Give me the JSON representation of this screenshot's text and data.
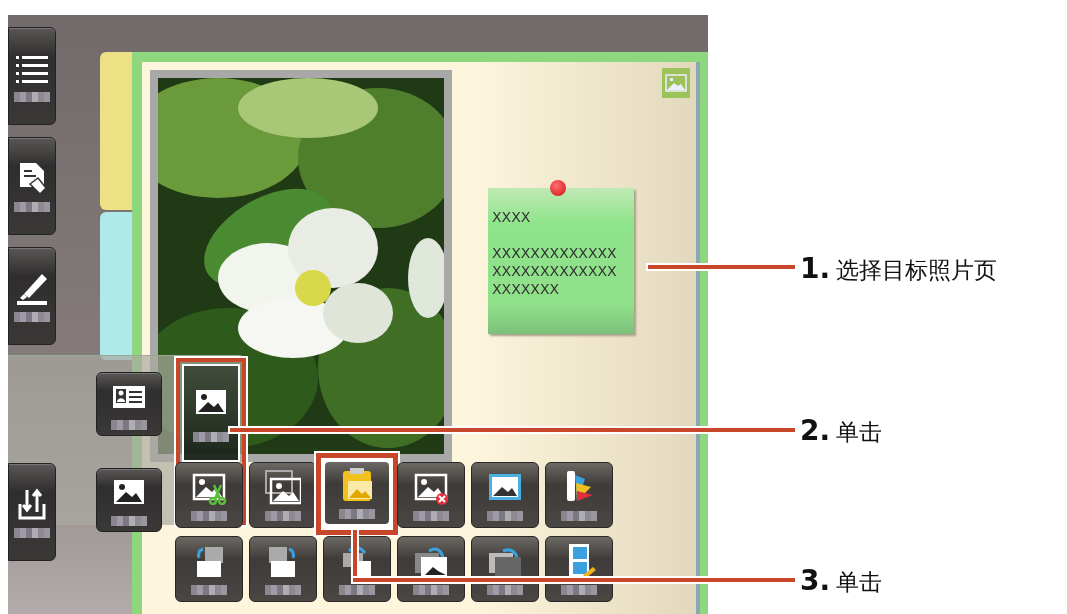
{
  "left_toolbar": [
    {
      "kind": "list"
    },
    {
      "kind": "document-hand"
    },
    {
      "kind": "highlighter"
    },
    {
      "kind": "transfer"
    }
  ],
  "side_panel": {
    "buttons": [
      {
        "kind": "id-card",
        "highlighted": false
      },
      {
        "kind": "picture",
        "highlighted": false
      }
    ],
    "expanded_button": {
      "kind": "picture",
      "highlighted": true
    }
  },
  "page_tabs": [
    {
      "color": "#ece285"
    },
    {
      "color": "#aeeaea"
    }
  ],
  "photo": {
    "kind": "picture"
  },
  "note": {
    "title": "XXXX",
    "lines": [
      "XXXXXXXXXXXXX",
      "XXXXXXXXXXXXX",
      "XXXXXXX"
    ]
  },
  "tool_grid": [
    {
      "kind": "cut-picture",
      "highlighted": false
    },
    {
      "kind": "copy-picture",
      "highlighted": false
    },
    {
      "kind": "paste-picture",
      "highlighted": true
    },
    {
      "kind": "delete-picture",
      "highlighted": false
    },
    {
      "kind": "frame-picture",
      "highlighted": false
    },
    {
      "kind": "palette",
      "highlighted": false
    },
    {
      "kind": "move-left",
      "highlighted": false
    },
    {
      "kind": "move-right",
      "highlighted": false
    },
    {
      "kind": "swap",
      "highlighted": false
    },
    {
      "kind": "bring-forward",
      "highlighted": false
    },
    {
      "kind": "send-back",
      "highlighted": false
    },
    {
      "kind": "layout-wrench",
      "highlighted": false
    }
  ],
  "callouts": [
    {
      "number": "1.",
      "text": "选择目标照片页"
    },
    {
      "number": "2.",
      "text": "单击"
    },
    {
      "number": "3.",
      "text": "单击"
    }
  ]
}
